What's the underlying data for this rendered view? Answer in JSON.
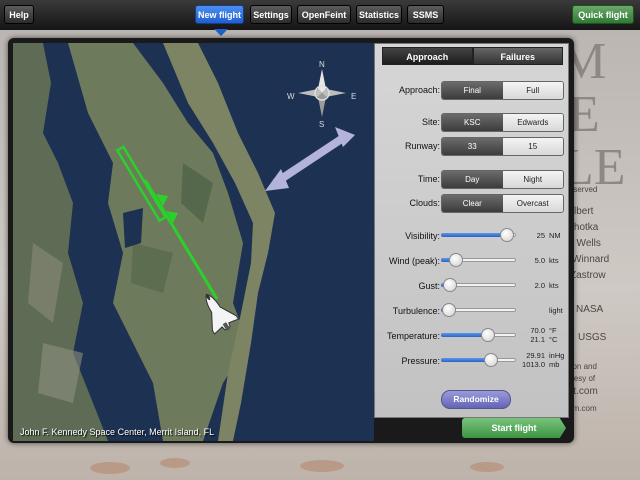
{
  "topbar": {
    "help": "Help",
    "new_flight": "New flight",
    "settings": "Settings",
    "openfeint": "OpenFeint",
    "statistics": "Statistics",
    "ssms": "SSMS",
    "quick_flight": "Quick flight"
  },
  "background_credits": {
    "big_letters": [
      "M",
      "E",
      "LE"
    ],
    "lines": [
      "s reserved",
      "Gilbert",
      "h Lhotka",
      "le Wells",
      "Winnard",
      "Zastrow",
      "NASA",
      "USGS",
      "ation and",
      "ourtesy of",
      "ight.com",
      "f-sim.com"
    ]
  },
  "map": {
    "caption": "John F. Kennedy Space Center, Merrit Island, FL",
    "compass": {
      "n": "N",
      "s": "S",
      "e": "E",
      "w": "W"
    }
  },
  "tabs": {
    "approach": "Approach",
    "failures": "Failures"
  },
  "approach": {
    "label": "Approach:",
    "options": [
      "Final",
      "Full"
    ],
    "selected": "Final"
  },
  "site": {
    "label": "Site:",
    "options": [
      "KSC",
      "Edwards"
    ],
    "selected": "KSC"
  },
  "runway": {
    "label": "Runway:",
    "options": [
      "33",
      "15"
    ],
    "selected": "33"
  },
  "time": {
    "label": "Time:",
    "options": [
      "Day",
      "Night"
    ],
    "selected": "Day"
  },
  "clouds": {
    "label": "Clouds:",
    "options": [
      "Clear",
      "Overcast"
    ],
    "selected": "Clear"
  },
  "visibility": {
    "label": "Visibility:",
    "value": "25",
    "unit": "NM",
    "level": 0.88
  },
  "wind": {
    "label": "Wind (peak):",
    "value": "5.0",
    "unit": "kts",
    "level": 0.2
  },
  "gust": {
    "label": "Gust:",
    "value": "2.0",
    "unit": "kts",
    "level": 0.12
  },
  "turbulence": {
    "label": "Turbulence:",
    "value": "",
    "unit": "light",
    "level": 0.1
  },
  "temperature": {
    "label": "Temperature:",
    "value": "70.0",
    "unit": "°F",
    "value2": "21.1",
    "unit2": "°C",
    "level": 0.62
  },
  "pressure": {
    "label": "Pressure:",
    "value": "29.91",
    "unit": "inHg",
    "value2": "1013.0",
    "unit2": "mb",
    "level": 0.66
  },
  "randomize": "Randomize",
  "start_flight": "Start flight",
  "colors": {
    "accent_blue": "#1f5fd0",
    "go_green": "#3d9543",
    "approach_line": "#2bd12b"
  }
}
